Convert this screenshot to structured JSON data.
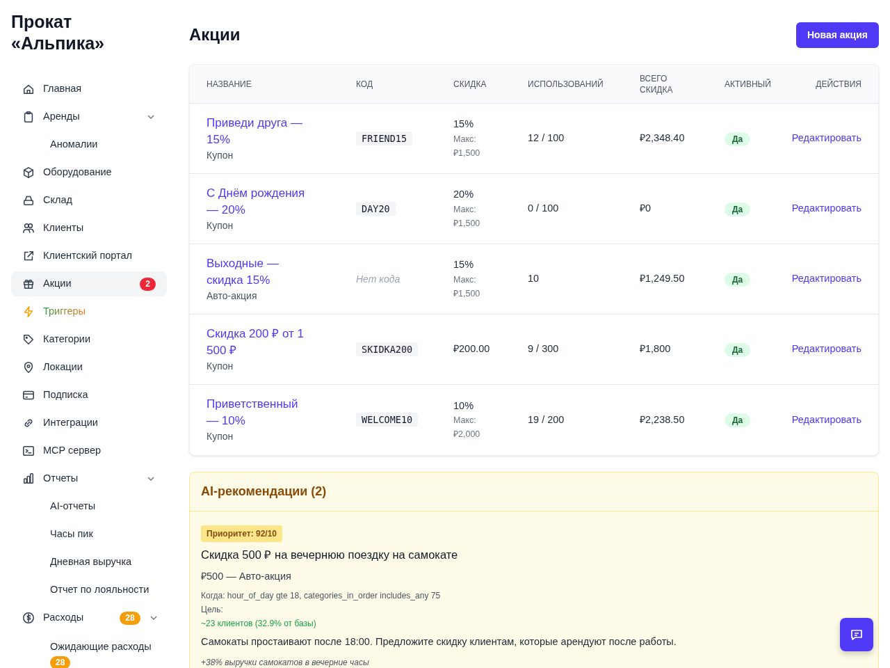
{
  "brand": "Прокат «Альпика»",
  "nav": [
    {
      "label": "Главная",
      "kind": "link",
      "selected": false
    },
    {
      "label": "Аренды",
      "kind": "link",
      "selected": false,
      "expanded": true,
      "children": [
        {
          "label": "Аномалии",
          "selected": false
        }
      ]
    },
    {
      "label": "Оборудование",
      "kind": "link",
      "selected": false
    },
    {
      "label": "Склад",
      "kind": "link",
      "selected": false
    },
    {
      "label": "Клиенты",
      "kind": "link",
      "selected": false
    },
    {
      "label": "Клиентский портал",
      "kind": "link",
      "selected": false
    },
    {
      "label": "Акции",
      "kind": "link",
      "selected": true,
      "badge": {
        "text": "2",
        "color": "#ef2637"
      }
    },
    {
      "label": "Триггеры",
      "kind": "highlight",
      "selected": false
    },
    {
      "label": "Категории",
      "kind": "link",
      "selected": false
    },
    {
      "label": "Локации",
      "kind": "link",
      "selected": false
    },
    {
      "label": "Подписка",
      "kind": "link",
      "selected": false
    },
    {
      "label": "Интеграции",
      "kind": "link",
      "selected": false
    },
    {
      "label": "MCP сервер",
      "kind": "link",
      "selected": false
    },
    {
      "label": "Отчеты",
      "kind": "link",
      "selected": false,
      "expanded": true,
      "children": [
        {
          "label": "AI-отчеты",
          "selected": false
        },
        {
          "label": "Часы пик",
          "selected": false
        },
        {
          "label": "Дневная выручка",
          "selected": false
        },
        {
          "label": "Отчет по лояльности",
          "selected": false
        }
      ]
    },
    {
      "label": "Расходы",
      "kind": "link",
      "selected": false,
      "badge": {
        "text": "28",
        "color": "#f59e0b"
      },
      "expanded": true,
      "children": [
        {
          "label": "Ожидающие расходы",
          "selected": false,
          "badge": {
            "text": "28",
            "color": "#f59e0b"
          }
        }
      ]
    }
  ],
  "page_title": "Акции",
  "new_button": "Новая акция",
  "table": {
    "columns": [
      "НАЗВАНИЕ",
      "КОД",
      "СКИДКА",
      "ИСПОЛЬЗОВАНИЙ",
      "ВСЕГО СКИДКА",
      "АКТИВНЫЙ",
      "ДЕЙСТВИЯ"
    ],
    "rows": [
      {
        "name": "Приведи друга — 15%",
        "type": "Купон",
        "code": "FRIEND15",
        "has_code": true,
        "discount": "15%",
        "max_label": "Макс:",
        "max_value": "₽1,500",
        "uses": "12 / 100",
        "total": "₽2,348.40",
        "active": true,
        "active_label": "Да",
        "action": "Редактировать"
      },
      {
        "name": "С Днём рождения — 20%",
        "type": "Купон",
        "code": "DAY20",
        "has_code": true,
        "discount": "20%",
        "max_label": "Макс:",
        "max_value": "₽1,500",
        "uses": "0 / 100",
        "total": "₽0",
        "active": true,
        "active_label": "Да",
        "action": "Редактировать"
      },
      {
        "name": "Выходные — скидка 15%",
        "type": "Авто-акция",
        "code": "Нет кода",
        "has_code": false,
        "discount": "15%",
        "max_label": "Макс:",
        "max_value": "₽1,500",
        "uses": "10",
        "total": "₽1,249.50",
        "active": true,
        "active_label": "Да",
        "action": "Редактировать"
      },
      {
        "name": "Скидка 200 ₽ от 1 500 ₽",
        "type": "Купон",
        "code": "SKIDKA200",
        "has_code": true,
        "discount": "₽200.00",
        "uses": "9 / 300",
        "total": "₽1,800",
        "active": true,
        "active_label": "Да",
        "action": "Редактировать"
      },
      {
        "name": "Приветственный — 10%",
        "type": "Купон",
        "code": "WELCOME10",
        "has_code": true,
        "discount": "10%",
        "max_label": "Макс:",
        "max_value": "₽2,000",
        "uses": "19 / 200",
        "total": "₽2,238.50",
        "active": true,
        "active_label": "Да",
        "action": "Редактировать"
      }
    ]
  },
  "ai": {
    "title": "AI-рекомендации (2)",
    "items": [
      {
        "priority": "Приоритет: 92/10",
        "title": "Скидка 500 ₽ на вечернюю поездку на самокате",
        "subtitle": "₽500 — Авто-акция",
        "when": "Когда: hour_of_day gte 18, categories_in_order includes_any 75",
        "goal_label": "Цель:",
        "goal": "~23 клиентов (32.9% от базы)",
        "description": "Самокаты простаивают после 18:00. Предложите скидку клиентам, которые арендуют после работы.",
        "impact": "+38% выручки самокатов в вечерние часы"
      }
    ]
  }
}
